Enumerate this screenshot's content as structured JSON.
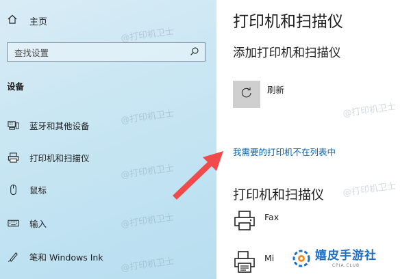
{
  "nav": {
    "home_label": "主页",
    "search": {
      "placeholder": "查找设置"
    },
    "section_title": "设备",
    "items": [
      {
        "label": "蓝牙和其他设备",
        "icon": "bluetooth-devices-icon"
      },
      {
        "label": "打印机和扫描仪",
        "icon": "printer-icon"
      },
      {
        "label": "鼠标",
        "icon": "mouse-icon"
      },
      {
        "label": "输入",
        "icon": "keyboard-icon"
      },
      {
        "label": "笔和 Windows Ink",
        "icon": "pen-icon"
      }
    ]
  },
  "content": {
    "title": "打印机和扫描仪",
    "add_heading": "添加打印机和扫描仪",
    "refresh_label": "刷新",
    "missing_printer_link": "我需要的打印机不在列表中",
    "list_heading": "打印机和扫描仪",
    "printers": [
      {
        "name": "Fax",
        "icon": "fax-printer-icon"
      },
      {
        "name": "Mi",
        "icon": "document-printer-icon"
      }
    ]
  },
  "annotation": {
    "arrow_color": "#f04a4a"
  },
  "watermark": "@打印机卫士",
  "logo": {
    "name": "嬉皮手游社",
    "sub": "CPIA.CLUB"
  },
  "colors": {
    "nav_bg": "#c9e6f3",
    "link": "#0063b1",
    "tile": "#cfcfcf",
    "logo_blue": "#1f6fc4"
  }
}
